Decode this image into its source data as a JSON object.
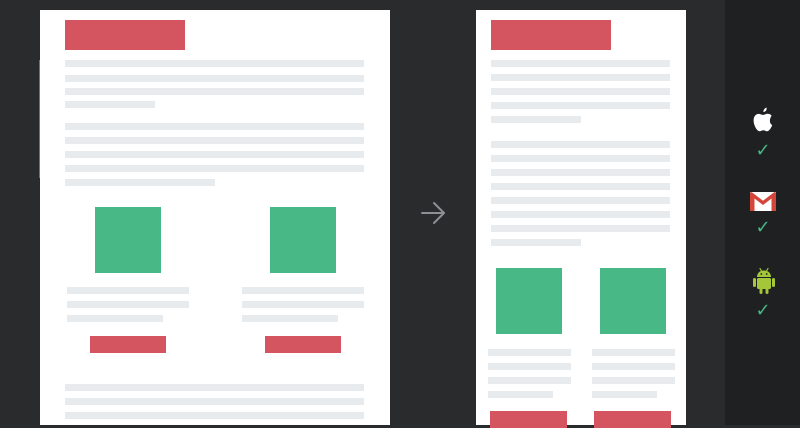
{
  "colors": {
    "background": "#2a2b2d",
    "side_panel": "#1f2021",
    "page": "#ffffff",
    "placeholder_bar": "#e8ebee",
    "heading_block": "#d4545f",
    "image_block": "#48b887",
    "check": "#48b887"
  },
  "icons": {
    "transition": "arrow-right-icon",
    "clients": [
      "apple-icon",
      "gmail-icon",
      "android-icon"
    ],
    "status": "checkmark-icon"
  },
  "client_status": {
    "apple": "✓",
    "gmail": "✓",
    "android": "✓"
  },
  "arrow_glyph": "→"
}
